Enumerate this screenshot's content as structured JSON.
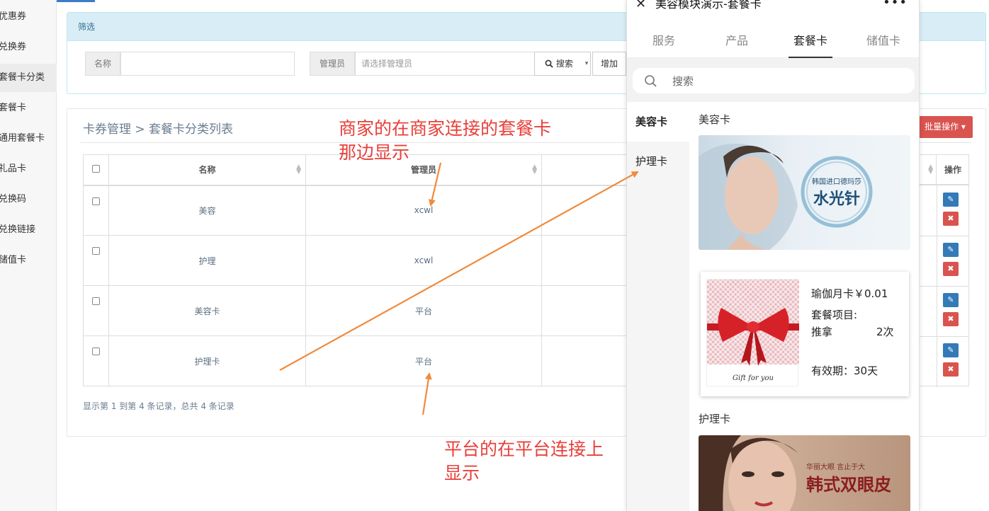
{
  "sidebar": {
    "items": [
      {
        "label": "优惠券",
        "active": false
      },
      {
        "label": "兑换券",
        "active": false
      },
      {
        "label": "套餐卡分类",
        "active": true
      },
      {
        "label": "套餐卡",
        "active": false
      },
      {
        "label": "通用套餐卡",
        "active": false
      },
      {
        "label": "礼品卡",
        "active": false
      },
      {
        "label": "兑换码",
        "active": false
      },
      {
        "label": "兑换链接",
        "active": false
      },
      {
        "label": "储值卡",
        "active": false
      }
    ]
  },
  "filter": {
    "heading": "筛选",
    "name_label": "名称",
    "name_value": "",
    "admin_label": "管理员",
    "admin_placeholder": "请选择管理员",
    "search_button": "搜索",
    "dropdown_caret": "▾",
    "add_button": "增加"
  },
  "list": {
    "breadcrumb": "卡券管理 > 套餐卡分类列表",
    "bulk_button": "批量操作 ▾",
    "columns": [
      "名称",
      "管理员",
      "操作"
    ],
    "rows": [
      {
        "name": "美容",
        "admin": "xcwl"
      },
      {
        "name": "护理",
        "admin": "xcwl"
      },
      {
        "name": "美容卡",
        "admin": "平台"
      },
      {
        "name": "护理卡",
        "admin": "平台"
      }
    ],
    "pager_text": "显示第 1 到第 4 条记录，总共 4 条记录"
  },
  "phone": {
    "title": "美容模块演示-套餐卡",
    "close_glyph": "✕",
    "more_glyph": "•••",
    "tabs": [
      {
        "label": "服务",
        "active": false
      },
      {
        "label": "产品",
        "active": false
      },
      {
        "label": "套餐卡",
        "active": true
      },
      {
        "label": "储值卡",
        "active": false
      }
    ],
    "search_placeholder": "搜索",
    "categories": [
      {
        "label": "美容卡",
        "active": true
      },
      {
        "label": "护理卡",
        "active": false
      }
    ],
    "section1_title": "美容卡",
    "banner1": {
      "line1": "韩国进口德玛莎",
      "line2": "水光针"
    },
    "gift_card": {
      "title": "瑜伽月卡￥0.01",
      "items_label": "套餐项目:",
      "item_name": "推拿",
      "item_count": "2次",
      "validity": "有效期：30天",
      "image_caption": "Gift for you"
    },
    "section2_title": "护理卡",
    "banner2": {
      "line1": "华丽大眼 言止于大",
      "line2": "韩式双眼皮"
    }
  },
  "annotations": {
    "top_line1": "商家的在商家连接的套餐卡",
    "top_line2": "那边显示",
    "bottom_line1": "平台的在平台连接上",
    "bottom_line2": "显示",
    "arrow_color": "#f08a3c",
    "text_color": "#e8403a"
  }
}
